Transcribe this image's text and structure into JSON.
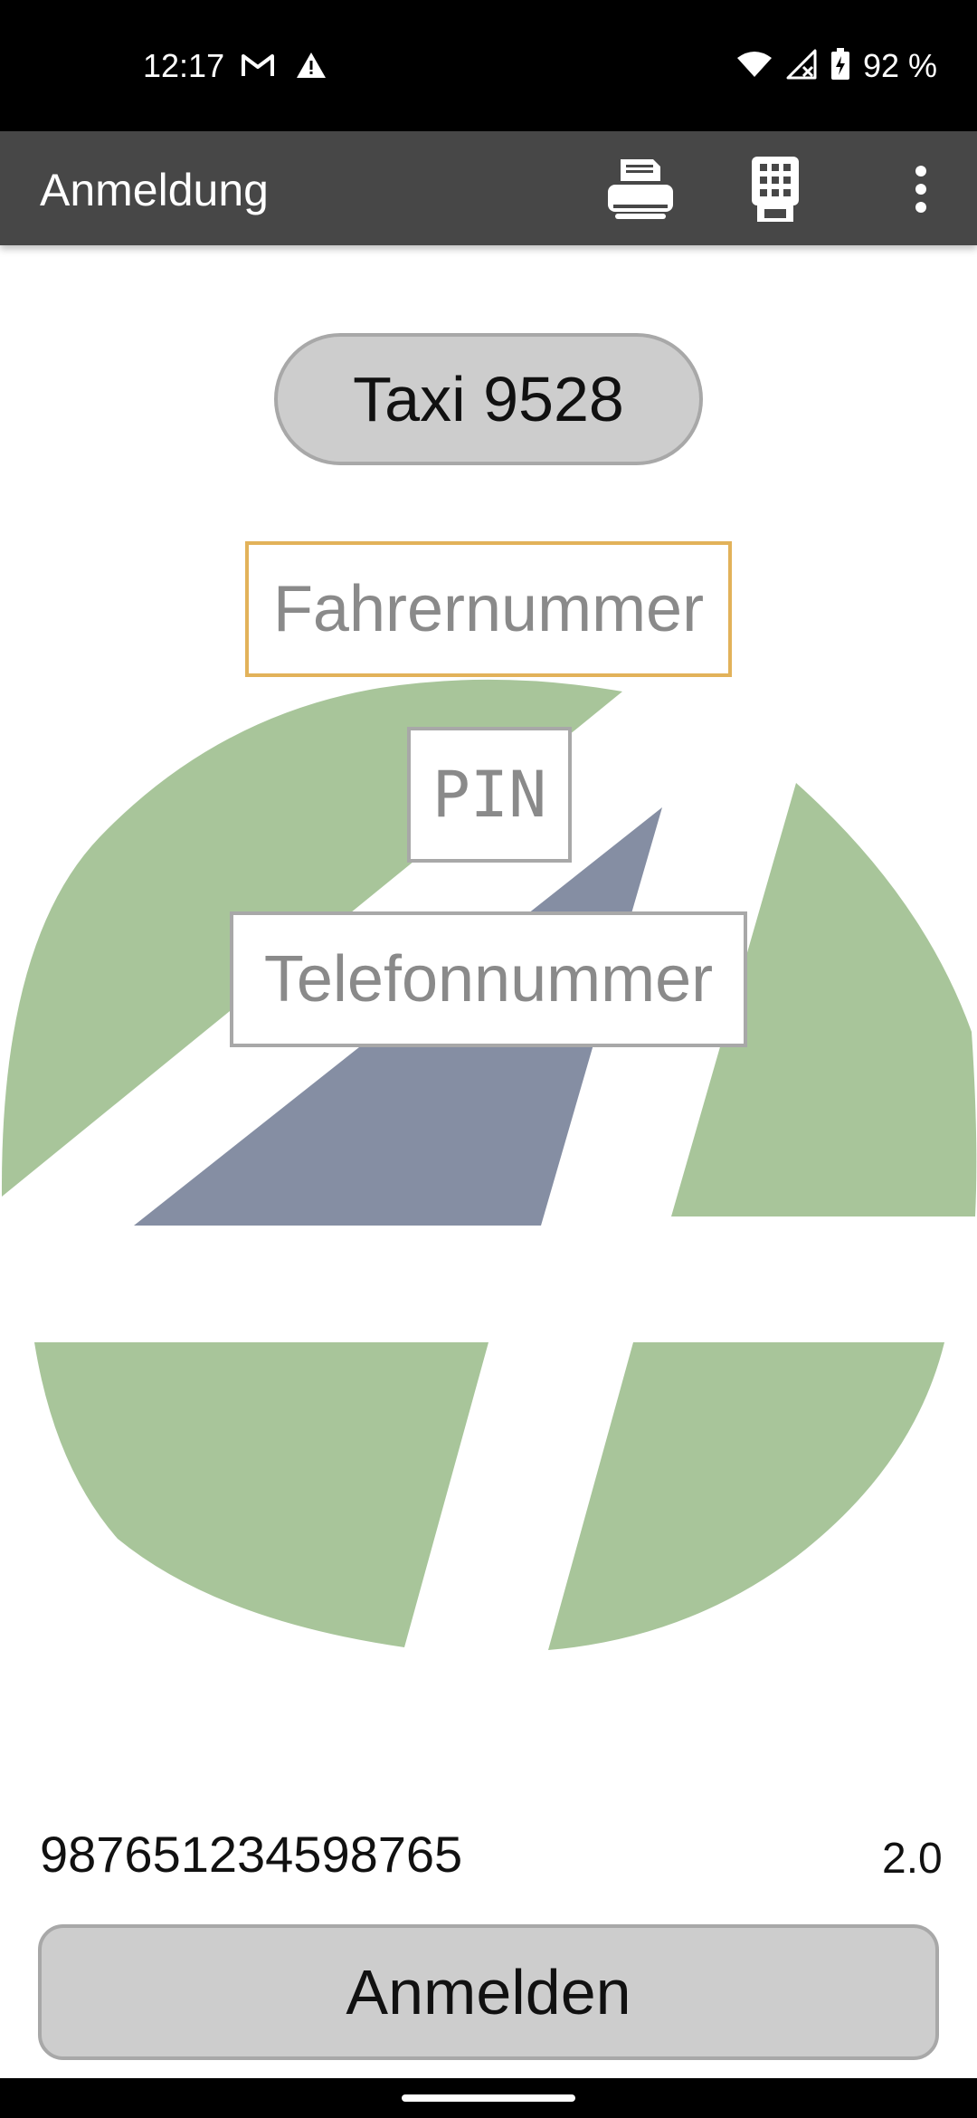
{
  "status_bar": {
    "time": "12:17",
    "battery_percent": "92 %",
    "icons": [
      "gmail-icon",
      "alert-icon",
      "wifi-icon",
      "no-signal-icon",
      "battery-charging-icon"
    ]
  },
  "app_bar": {
    "title": "Anmeldung",
    "actions": [
      "printer-icon",
      "keypad-icon",
      "overflow-menu-icon"
    ],
    "background": "#474747"
  },
  "vehicle": {
    "label": "Taxi 9528"
  },
  "form": {
    "driver_number_placeholder": "Fahrernummer",
    "driver_number_value": "",
    "pin_placeholder": "PIN",
    "pin_value": "",
    "phone_placeholder": "Telefonnummer",
    "phone_value": ""
  },
  "footer": {
    "device_id": "987651234598765",
    "version": "2.0",
    "login_label": "Anmelden"
  },
  "colors": {
    "logo_green": "#a8c59a",
    "logo_slate": "#858ea3",
    "focus_border": "#e2b25a"
  }
}
